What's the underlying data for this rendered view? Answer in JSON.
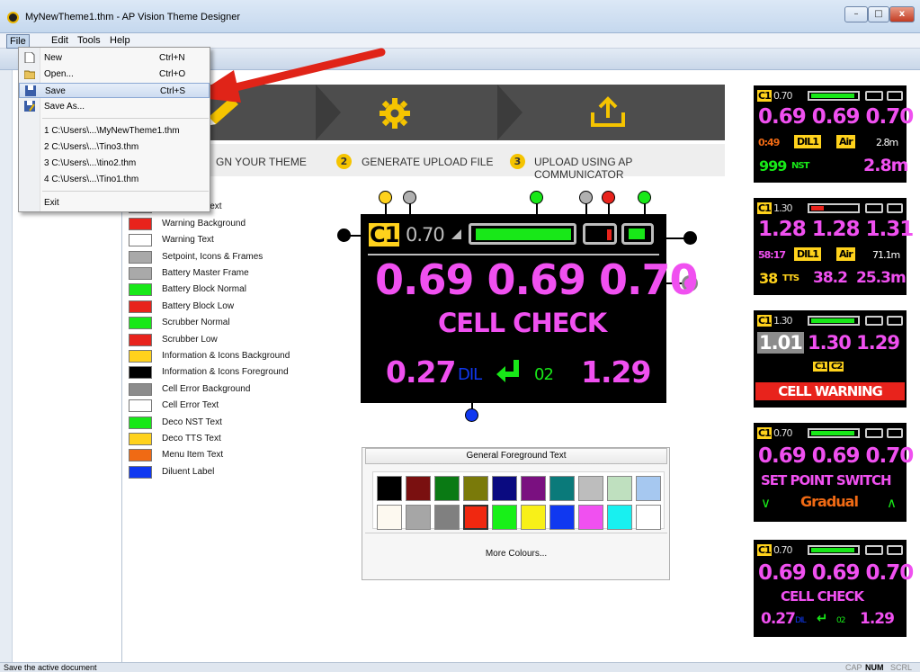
{
  "window": {
    "title": "MyNewTheme1.thm - AP Vision Theme Designer",
    "min": "–",
    "max": "□",
    "close": "x"
  },
  "menu": {
    "file": "File",
    "edit": "Edit",
    "tools": "Tools",
    "help": "Help"
  },
  "file_menu": {
    "new": "New",
    "new_key": "Ctrl+N",
    "open": "Open...",
    "open_key": "Ctrl+O",
    "save": "Save",
    "save_key": "Ctrl+S",
    "save_as": "Save As...",
    "recent": [
      "1 C:\\Users\\...\\MyNewTheme1.thm",
      "2 C:\\Users\\...\\Tino3.thm",
      "3 C:\\Users\\...\\tino2.thm",
      "4 C:\\Users\\...\\Tino1.thm"
    ],
    "exit": "Exit"
  },
  "steps": [
    {
      "num": "1",
      "label": "GN YOUR THEME"
    },
    {
      "num": "2",
      "label": "GENERATE UPLOAD FILE"
    },
    {
      "num": "3",
      "label": "UPLOAD USING AP COMMUNICATOR"
    }
  ],
  "theme_items": [
    {
      "label": "nd",
      "color": "#000000"
    },
    {
      "label": "oreground Text",
      "color": "#ffffff"
    },
    {
      "label": "Warning Background",
      "color": "#e8231c"
    },
    {
      "label": "Warning Text",
      "color": "#ffffff"
    },
    {
      "label": "Setpoint, Icons & Frames",
      "color": "#a9a9a9"
    },
    {
      "label": "Battery Master Frame",
      "color": "#a9a9a9"
    },
    {
      "label": "Battery Block Normal",
      "color": "#18e818"
    },
    {
      "label": "Battery Block Low",
      "color": "#e8231c"
    },
    {
      "label": "Scrubber Normal",
      "color": "#18e818"
    },
    {
      "label": "Scrubber Low",
      "color": "#e8231c"
    },
    {
      "label": "Information & Icons Background",
      "color": "#ffd21c"
    },
    {
      "label": "Information & Icons Foreground",
      "color": "#000000"
    },
    {
      "label": "Cell Error Background",
      "color": "#8c8c8c"
    },
    {
      "label": "Cell Error Text",
      "color": "#ffffff"
    },
    {
      "label": "Deco NST Text",
      "color": "#18e818"
    },
    {
      "label": "Deco TTS Text",
      "color": "#ffd21c"
    },
    {
      "label": "Menu Item Text",
      "color": "#f06a14"
    },
    {
      "label": "Diluent Label",
      "color": "#1038f0"
    }
  ],
  "main_display": {
    "cell_badge": "C1",
    "setpoint": "0.70",
    "ppo2": "0.69 0.69 0.70",
    "message": "CELL CHECK",
    "diluent_value": "0.27",
    "diluent_label": "DIL",
    "o2_label": "02",
    "o2_value": "1.29"
  },
  "palette": {
    "header": "General Foreground Text",
    "colors": [
      "#000000",
      "#7a1010",
      "#0a7a14",
      "#7a7a0a",
      "#0a0a80",
      "#7a1080",
      "#0a7a7a",
      "#bdbdbd",
      "#bfe0bf",
      "#a6c8f0",
      "#fdf9f0",
      "#a6a6a6",
      "#808080",
      "#f02810",
      "#18f018",
      "#f8f018",
      "#1038f0",
      "#f050f0",
      "#18f0f0",
      "#ffffff"
    ],
    "more": "More Colours..."
  },
  "previews": [
    {
      "badge": "C1",
      "sp": "0.70",
      "ppo2": "0.69 0.69 0.70",
      "time": "0:49",
      "dil": "DIL1",
      "gas": "Air",
      "depth": "2.8m",
      "nst": "999",
      "nst_label": "NST",
      "depth2": "2.8m"
    },
    {
      "badge": "C1",
      "sp": "1.30",
      "ppo2": "1.28 1.28 1.31",
      "time": "58:17",
      "dil": "DIL1",
      "gas": "Air",
      "depth": "71.1m",
      "tts": "38",
      "tts_label": "TTS",
      "val2": "38.2",
      "depth2": "25.3m"
    },
    {
      "badge": "C1",
      "sp": "1.30",
      "cell_err": "1.01",
      "ppo2_rest": "1.30 1.29",
      "c1": "C1",
      "c2": "C2",
      "warning": "CELL WARNING"
    },
    {
      "badge": "C1",
      "sp": "0.70",
      "ppo2": "0.69 0.69 0.70",
      "msg": "SET POINT SWITCH",
      "down": "∨",
      "mode": "Gradual",
      "up": "∧"
    },
    {
      "badge": "C1",
      "sp": "0.70",
      "ppo2": "0.69 0.69 0.70",
      "msg": "CELL CHECK",
      "dil_val": "0.27",
      "dil_lbl": "DIL",
      "o2_lbl": "02",
      "o2_val": "1.29"
    }
  ],
  "status": {
    "text": "Save the active document",
    "cap": "CAP",
    "num": "NUM",
    "scrl": "SCRL"
  }
}
